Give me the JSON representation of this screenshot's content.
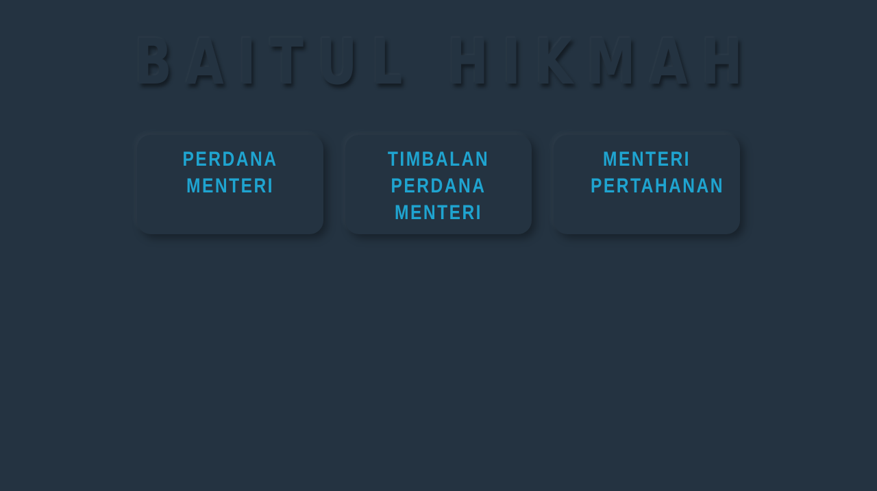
{
  "header": {
    "title": "BAITUL HIKMAH"
  },
  "cards": [
    {
      "label": "PERDANA\nMENTERI"
    },
    {
      "label": "TIMBALAN\nPERDANA\nMENTERI"
    },
    {
      "label": "MENTERI\nPERTAHANAN"
    }
  ],
  "colors": {
    "background": "#243341",
    "accent": "#1fa4d0"
  }
}
